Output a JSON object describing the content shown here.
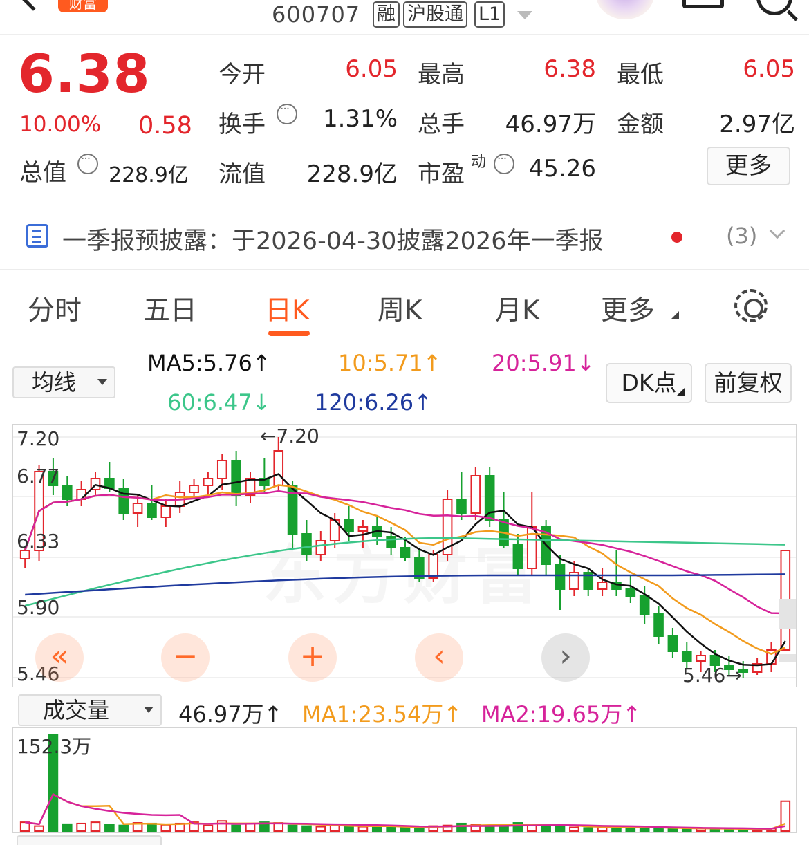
{
  "header": {
    "badge": "财富",
    "code": "600707",
    "tags": [
      "融",
      "沪股通",
      "L1"
    ]
  },
  "quote": {
    "price": "6.38",
    "change_pct": "10.00%",
    "change": "0.58",
    "cap_label": "总值",
    "cap_value": "228.9亿",
    "open_label": "今开",
    "open_value": "6.05",
    "high_label": "最高",
    "high_value": "6.38",
    "low_label": "最低",
    "low_value": "6.05",
    "turnover_label": "换手",
    "turnover_value": "1.31%",
    "volume_label": "总手",
    "volume_value": "46.97万",
    "amount_label": "金额",
    "amount_value": "2.97亿",
    "float_label": "流值",
    "float_value": "228.9亿",
    "pe_label": "市盈",
    "pe_sup": "动",
    "pe_value": "45.26",
    "more_label": "更多"
  },
  "notice": {
    "text": "一季报预披露：于2026-04-30披露2026年一季报",
    "count": "(3)"
  },
  "tabs": [
    {
      "label": "分时"
    },
    {
      "label": "五日"
    },
    {
      "label": "日K"
    },
    {
      "label": "周K"
    },
    {
      "label": "月K"
    },
    {
      "label": "更多"
    }
  ],
  "ma_bar": {
    "selector": "均线",
    "ma5": "MA5:5.76↑",
    "ma10": "10:5.71↑",
    "ma20": "20:5.91↓",
    "ma60": "60:6.47↓",
    "ma120": "120:6.26↑",
    "dk_label": "DK点",
    "fq_label": "前复权"
  },
  "chart_labels": {
    "y_top": "7.20",
    "y_2": "6.77",
    "y_3": "6.33",
    "y_4": "5.90",
    "y_bottom": "5.46",
    "max_annot": "←7.20",
    "min_annot": "5.46→",
    "watermark": "东方财富"
  },
  "volume_bar": {
    "selector": "成交量",
    "vol": "46.97万↑",
    "ma1": "MA1:23.54万↑",
    "ma2": "MA2:19.65万↑",
    "max_label": "152.3万"
  },
  "colors": {
    "up": "#e3262c",
    "down": "#17a12f",
    "ma5": "#111111",
    "ma10": "#f29b1d",
    "ma20": "#d6239a",
    "ma60": "#3cc68a",
    "ma120": "#1f3a9e",
    "accent": "#ff5a1f"
  },
  "chart_data": {
    "type": "candlestick",
    "ylim": [
      5.46,
      7.2
    ],
    "yticks": [
      7.2,
      6.77,
      6.33,
      5.9,
      5.46
    ],
    "ohlc": [
      [
        6.32,
        6.4,
        6.25,
        6.38
      ],
      [
        6.38,
        7.0,
        6.3,
        6.95
      ],
      [
        6.95,
        7.05,
        6.78,
        6.85
      ],
      [
        6.85,
        6.92,
        6.7,
        6.75
      ],
      [
        6.75,
        6.88,
        6.7,
        6.82
      ],
      [
        6.82,
        6.95,
        6.78,
        6.9
      ],
      [
        6.9,
        7.02,
        6.8,
        6.83
      ],
      [
        6.83,
        6.9,
        6.6,
        6.65
      ],
      [
        6.65,
        6.78,
        6.55,
        6.72
      ],
      [
        6.72,
        6.85,
        6.6,
        6.62
      ],
      [
        6.62,
        6.75,
        6.55,
        6.7
      ],
      [
        6.7,
        6.88,
        6.65,
        6.8
      ],
      [
        6.8,
        6.9,
        6.75,
        6.85
      ],
      [
        6.85,
        6.95,
        6.78,
        6.9
      ],
      [
        6.9,
        7.08,
        6.82,
        7.03
      ],
      [
        7.03,
        7.1,
        6.7,
        6.78
      ],
      [
        6.78,
        6.95,
        6.72,
        6.9
      ],
      [
        6.9,
        7.05,
        6.8,
        6.85
      ],
      [
        6.85,
        7.2,
        6.8,
        7.1
      ],
      [
        6.85,
        6.88,
        6.4,
        6.5
      ],
      [
        6.5,
        6.6,
        6.3,
        6.35
      ],
      [
        6.35,
        6.52,
        6.3,
        6.45
      ],
      [
        6.45,
        6.65,
        6.4,
        6.6
      ],
      [
        6.6,
        6.7,
        6.45,
        6.52
      ],
      [
        6.52,
        6.6,
        6.4,
        6.55
      ],
      [
        6.55,
        6.62,
        6.42,
        6.48
      ],
      [
        6.48,
        6.55,
        6.35,
        6.4
      ],
      [
        6.4,
        6.48,
        6.3,
        6.33
      ],
      [
        6.33,
        6.4,
        6.15,
        6.18
      ],
      [
        6.18,
        6.38,
        6.15,
        6.35
      ],
      [
        6.35,
        6.82,
        6.3,
        6.75
      ],
      [
        6.75,
        6.95,
        6.6,
        6.65
      ],
      [
        6.65,
        6.98,
        6.6,
        6.92
      ],
      [
        6.92,
        6.98,
        6.55,
        6.6
      ],
      [
        6.6,
        6.8,
        6.4,
        6.42
      ],
      [
        6.42,
        6.5,
        6.2,
        6.25
      ],
      [
        6.25,
        6.8,
        6.2,
        6.55
      ],
      [
        6.55,
        6.6,
        6.2,
        6.28
      ],
      [
        6.28,
        6.35,
        5.95,
        6.1
      ],
      [
        6.1,
        6.3,
        6.05,
        6.22
      ],
      [
        6.22,
        6.25,
        6.05,
        6.1
      ],
      [
        6.1,
        6.25,
        6.05,
        6.15
      ],
      [
        6.15,
        6.38,
        6.05,
        6.1
      ],
      [
        6.1,
        6.2,
        6.0,
        6.05
      ],
      [
        6.05,
        6.12,
        5.85,
        5.92
      ],
      [
        5.92,
        5.98,
        5.7,
        5.76
      ],
      [
        5.76,
        5.82,
        5.6,
        5.65
      ],
      [
        5.65,
        5.72,
        5.52,
        5.58
      ],
      [
        5.58,
        5.65,
        5.5,
        5.62
      ],
      [
        5.62,
        5.66,
        5.5,
        5.55
      ],
      [
        5.55,
        5.62,
        5.48,
        5.52
      ],
      [
        5.52,
        5.58,
        5.46,
        5.5
      ],
      [
        5.5,
        5.6,
        5.48,
        5.56
      ],
      [
        5.56,
        5.72,
        5.5,
        5.66
      ],
      [
        5.66,
        6.38,
        5.66,
        6.38
      ]
    ],
    "volume_unit": "万",
    "volume": [
      14,
      8,
      152,
      11,
      12,
      14,
      10,
      9,
      13,
      12,
      10,
      12,
      14,
      9,
      16,
      9,
      12,
      14,
      13,
      9,
      8,
      7,
      10,
      8,
      7,
      7,
      7,
      6,
      6,
      8,
      9,
      12,
      10,
      9,
      8,
      13,
      9,
      9,
      8,
      6,
      5,
      6,
      7,
      6,
      5,
      4,
      4,
      4,
      4,
      4,
      3,
      3,
      3,
      4,
      46.97
    ]
  }
}
